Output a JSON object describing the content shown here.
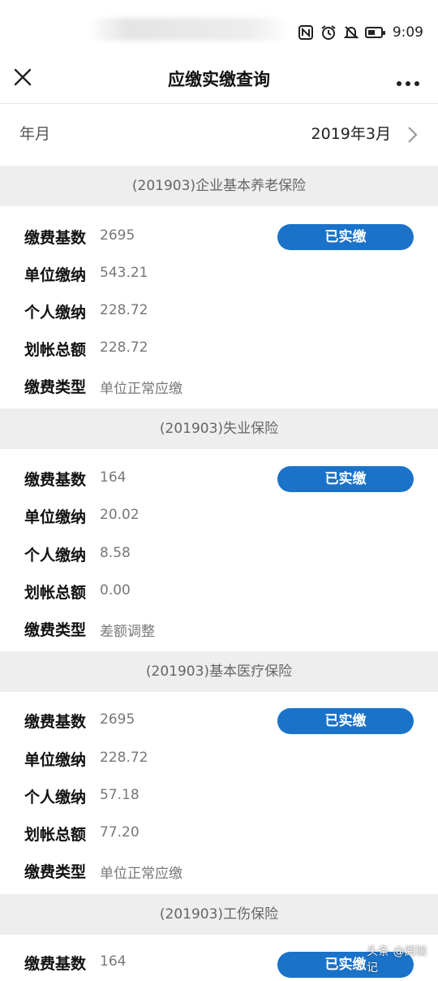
{
  "status_bar": {
    "time": "9:09",
    "icons": [
      "nfc-icon",
      "alarm-icon",
      "mute-bell-icon",
      "battery-icon"
    ]
  },
  "nav": {
    "title": "应缴实缴查询",
    "close_icon": "close-icon",
    "more_icon": "more-icon"
  },
  "period": {
    "label": "年月",
    "value": "2019年3月"
  },
  "field_labels": {
    "base": "缴费基数",
    "unit": "单位缴纳",
    "personal": "个人缴纳",
    "account": "划帐总额",
    "type": "缴费类型"
  },
  "sections": [
    {
      "title": "(201903)企业基本养老保险",
      "status": "已实缴",
      "base": "2695",
      "unit": "543.21",
      "personal": "228.72",
      "account": "228.72",
      "type": "单位正常应缴"
    },
    {
      "title": "(201903)失业保险",
      "status": "已实缴",
      "base": "164",
      "unit": "20.02",
      "personal": "8.58",
      "account": "0.00",
      "type": "差额调整"
    },
    {
      "title": "(201903)基本医疗保险",
      "status": "已实缴",
      "base": "2695",
      "unit": "228.72",
      "personal": "57.18",
      "account": "77.20",
      "type": "单位正常应缴"
    },
    {
      "title": "(201903)工伤保险",
      "status": "已实缴",
      "base": "164"
    }
  ],
  "watermark": {
    "text": "头条 @阅验记"
  },
  "colors": {
    "accent": "#1a73c9",
    "section_bg": "#eeeeee",
    "label": "#111111",
    "value": "#777777"
  }
}
